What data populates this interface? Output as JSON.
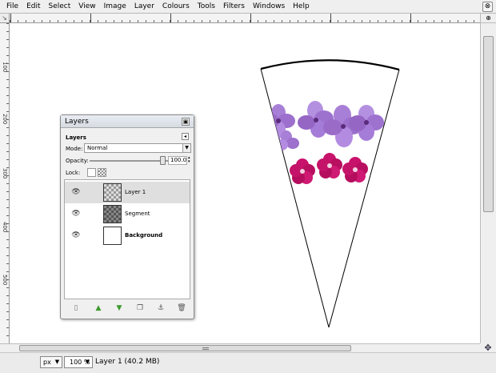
{
  "menu": {
    "items": [
      "File",
      "Edit",
      "Select",
      "View",
      "Image",
      "Layer",
      "Colours",
      "Tools",
      "Filters",
      "Windows",
      "Help"
    ],
    "close_glyph": "⊗"
  },
  "rulers": {
    "vertical_labels": [
      "100",
      "200",
      "300",
      "400",
      "500"
    ],
    "corner_glyph": "↘"
  },
  "layers_dialog": {
    "title": "Layers",
    "header": "Layers",
    "mode_label": "Mode:",
    "mode_value": "Normal",
    "opacity_label": "Opacity:",
    "opacity_value": "100.0",
    "opacity_percent": 100,
    "lock_label": "Lock:",
    "layers": [
      {
        "name": "Layer 1",
        "selected": true,
        "thumb": "checker"
      },
      {
        "name": "Segment",
        "selected": false,
        "thumb": "checker-dark"
      },
      {
        "name": "Background",
        "selected": false,
        "thumb": "white"
      }
    ],
    "toolbar_icons": [
      "new-layer-icon",
      "raise-layer-icon",
      "lower-layer-icon",
      "duplicate-layer-icon",
      "anchor-layer-icon",
      "delete-layer-icon"
    ]
  },
  "statusbar": {
    "unit": "px",
    "zoom": "100 %",
    "text": "Layer 1 (40.2 MB)"
  },
  "colors": {
    "flower_purple": "#a87fd6",
    "flower_magenta": "#c8126b",
    "selection": "#dfdfdf"
  }
}
